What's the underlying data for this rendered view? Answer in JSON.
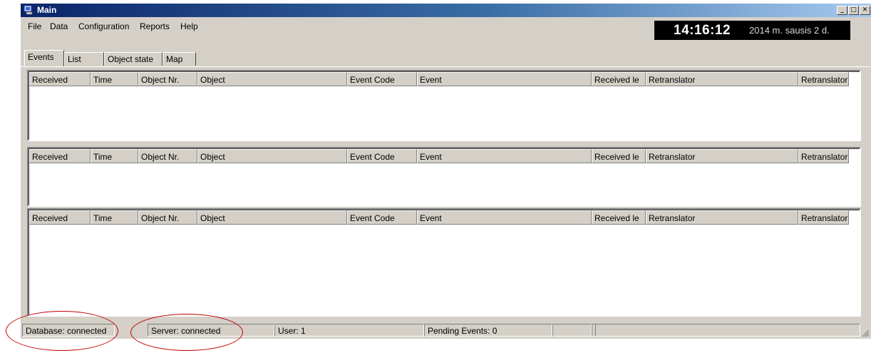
{
  "window": {
    "title": "Main",
    "icon": "monitor-app-icon",
    "controls": {
      "minimize": "_",
      "maximize": "□",
      "close": "✕"
    }
  },
  "menu": [
    "File",
    "Data",
    "Configuration",
    "Reports",
    "Help"
  ],
  "clock": {
    "time": "14:16:12",
    "date": "2014 m. sausis 2 d."
  },
  "tabs": [
    {
      "label": "Events",
      "active": true
    },
    {
      "label": "List",
      "active": false
    },
    {
      "label": "Object state",
      "active": false
    },
    {
      "label": "Map",
      "active": false
    }
  ],
  "grid_columns": [
    "Received",
    "Time",
    "Object Nr.",
    "Object",
    "Event Code",
    "Event",
    "Received le",
    "Retranslator",
    "Retranslator"
  ],
  "status": {
    "database": "Database: connected",
    "server": "Server: connected",
    "user": "User: 1",
    "pending": "Pending Events: 0"
  },
  "colors": {
    "title_gradient_start": "#0a246a",
    "title_gradient_end": "#a6caf0",
    "face": "#d4d0c8",
    "annotation": "#c00000"
  }
}
